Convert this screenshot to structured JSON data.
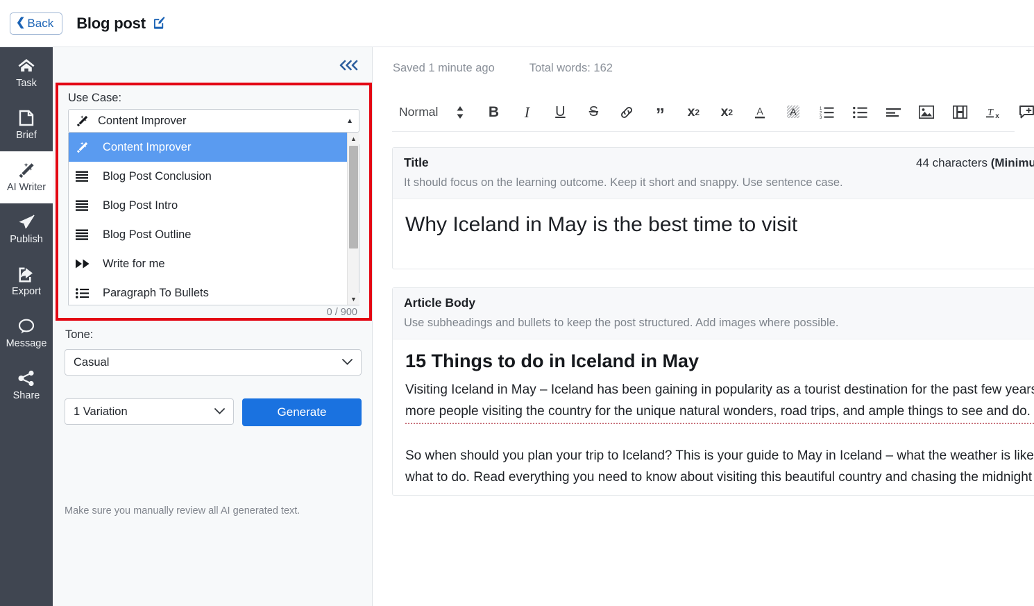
{
  "topbar": {
    "back_label": "Back",
    "back_icon": "chevron-left-icon",
    "page_title": "Blog post",
    "edit_icon": "edit-pencil-square-icon"
  },
  "rail": {
    "items": [
      {
        "label": "Task",
        "icon": "home-icon",
        "active": false
      },
      {
        "label": "Brief",
        "icon": "document-icon",
        "active": false
      },
      {
        "label": "AI Writer",
        "icon": "magic-wand-icon",
        "active": true
      },
      {
        "label": "Publish",
        "icon": "paper-plane-icon",
        "active": false
      },
      {
        "label": "Export",
        "icon": "export-share-box-icon",
        "active": false
      },
      {
        "label": "Message",
        "icon": "speech-bubble-icon",
        "active": false
      },
      {
        "label": "Share",
        "icon": "share-nodes-icon",
        "active": false
      }
    ]
  },
  "panel": {
    "collapse_icon": "triple-chevron-left-icon",
    "collapse_glyph": "‹‹‹",
    "use_case": {
      "label": "Use Case:",
      "selected": "Content Improver",
      "selected_icon": "magic-wand-icon",
      "caret_icon": "caret-up-icon",
      "counter": "0 / 900",
      "options": [
        {
          "label": "Content Improver",
          "icon": "magic-wand-icon",
          "selected": true
        },
        {
          "label": "Blog Post Conclusion",
          "icon": "text-lines-icon",
          "selected": false
        },
        {
          "label": "Blog Post Intro",
          "icon": "text-lines-icon",
          "selected": false
        },
        {
          "label": "Blog Post Outline",
          "icon": "text-lines-icon",
          "selected": false
        },
        {
          "label": "Write for me",
          "icon": "fast-forward-icon",
          "selected": false
        },
        {
          "label": "Paragraph To Bullets",
          "icon": "bullet-list-icon",
          "selected": false
        }
      ]
    },
    "tone": {
      "label": "Tone:",
      "selected": "Casual",
      "caret_icon": "chevron-down-icon"
    },
    "variations": {
      "selected": "1 Variation",
      "caret_icon": "chevron-down-icon"
    },
    "generate_label": "Generate",
    "note": "Make sure you manually review all AI generated text."
  },
  "editor": {
    "saved_status": "Saved 1 minute ago",
    "word_count": "Total words: 162",
    "toolbar": {
      "format_label": "Normal",
      "items": [
        {
          "name": "format-dropdown-stepper-icon",
          "glyph": "↕"
        },
        {
          "name": "bold-icon",
          "glyph": "B"
        },
        {
          "name": "italic-icon",
          "glyph": "I"
        },
        {
          "name": "underline-icon",
          "glyph": "U"
        },
        {
          "name": "strikethrough-icon",
          "glyph": "S"
        },
        {
          "name": "link-icon",
          "glyph": "link"
        },
        {
          "name": "blockquote-icon",
          "glyph": "”"
        },
        {
          "name": "subscript-icon",
          "glyph": "x2"
        },
        {
          "name": "superscript-icon",
          "glyph": "x2"
        },
        {
          "name": "text-color-icon",
          "glyph": "A"
        },
        {
          "name": "highlight-color-icon",
          "glyph": "A"
        },
        {
          "name": "numbered-list-icon",
          "glyph": "list"
        },
        {
          "name": "bullet-list-icon",
          "glyph": "list"
        },
        {
          "name": "align-icon",
          "glyph": "align"
        },
        {
          "name": "insert-image-icon",
          "glyph": "image"
        },
        {
          "name": "insert-video-icon",
          "glyph": "film"
        },
        {
          "name": "clear-formatting-icon",
          "glyph": "Tx"
        },
        {
          "name": "add-comment-icon",
          "glyph": "comment"
        }
      ]
    },
    "sections": [
      {
        "name": "Title",
        "count_prefix": "44 characters ",
        "count_bold": "(Minimum",
        "hint": "It should focus on the learning outcome. Keep it short and snappy. Use sentence case.",
        "content": "Why Iceland in May is the best time to visit"
      },
      {
        "name": "Article Body",
        "hint": "Use subheadings and bullets to keep the post structured. Add images where possible.",
        "heading": "15 Things to do in Iceland in May",
        "paragraph_1": "Visiting Iceland in May – Iceland has been gaining in popularity as a tourist destination for the past few years, with more and more people visiting the country for the unique natural wonders, road trips, and ample things to see and do.",
        "paragraph_2": "So when should you plan your trip to Iceland? This is your guide to May in Iceland – what the weather is like, what to pack, and what to do. Read everything you need to know about visiting this beautiful country and chasing the midnight sun."
      }
    ]
  },
  "colors": {
    "rail_bg": "#404651",
    "accent_blue": "#1a72e0",
    "highlight_blue": "#5a9bf0",
    "alert_red": "#e30613",
    "panel_bg": "#f7f9fa"
  }
}
